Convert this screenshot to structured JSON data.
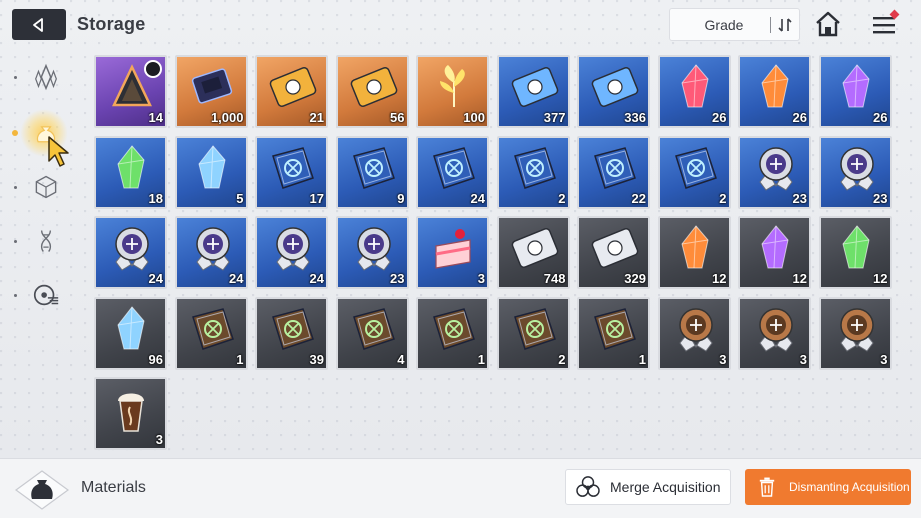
{
  "header": {
    "title": "Storage",
    "sort_label": "Grade"
  },
  "sidebar": {
    "items": [
      {
        "icon": "crystal-icon",
        "active": false
      },
      {
        "icon": "pouch-icon",
        "active": true
      },
      {
        "icon": "cube-icon",
        "active": false
      },
      {
        "icon": "dna-icon",
        "active": false
      },
      {
        "icon": "module-icon",
        "active": false
      }
    ]
  },
  "items": [
    {
      "icon": "chip-pyramid-icon",
      "grade": "purple",
      "qty": "14",
      "timer": true
    },
    {
      "icon": "memory-chip-icon",
      "grade": "orange",
      "qty": "1,000"
    },
    {
      "icon": "gold-ticket-icon",
      "grade": "orange",
      "qty": "21"
    },
    {
      "icon": "gold-compass-ticket-icon",
      "grade": "orange",
      "qty": "56"
    },
    {
      "icon": "golden-sprout-icon",
      "grade": "orange",
      "qty": "100"
    },
    {
      "icon": "blue-profile-ticket-icon",
      "grade": "blue",
      "qty": "377"
    },
    {
      "icon": "blue-compass-ticket-icon",
      "grade": "blue",
      "qty": "336"
    },
    {
      "icon": "red-crystal-icon",
      "grade": "blue",
      "qty": "26"
    },
    {
      "icon": "orange-crystal-icon",
      "grade": "blue",
      "qty": "26"
    },
    {
      "icon": "purple-crystal-icon",
      "grade": "blue",
      "qty": "26"
    },
    {
      "icon": "green-crystal-icon",
      "grade": "blue",
      "qty": "18"
    },
    {
      "icon": "blue-crystal-icon",
      "grade": "blue",
      "qty": "5"
    },
    {
      "icon": "blue-book-swords-icon",
      "grade": "blue",
      "qty": "17"
    },
    {
      "icon": "blue-book-shield-icon",
      "grade": "blue",
      "qty": "9"
    },
    {
      "icon": "blue-book-eye-icon",
      "grade": "blue",
      "qty": "24"
    },
    {
      "icon": "blue-book-wing-icon",
      "grade": "blue",
      "qty": "2"
    },
    {
      "icon": "blue-book-bolt-icon",
      "grade": "blue",
      "qty": "22"
    },
    {
      "icon": "blue-book-target-icon",
      "grade": "blue",
      "qty": "2"
    },
    {
      "icon": "silver-medal-cross-icon",
      "grade": "blue",
      "qty": "23"
    },
    {
      "icon": "silver-medal-shield-icon",
      "grade": "blue",
      "qty": "23"
    },
    {
      "icon": "silver-medal-eye-icon",
      "grade": "blue",
      "qty": "24"
    },
    {
      "icon": "silver-medal-wing-icon",
      "grade": "blue",
      "qty": "24"
    },
    {
      "icon": "silver-medal-bolt-icon",
      "grade": "blue",
      "qty": "24"
    },
    {
      "icon": "silver-medal-target-icon",
      "grade": "blue",
      "qty": "23"
    },
    {
      "icon": "strawberry-cake-icon",
      "grade": "blue",
      "qty": "3"
    },
    {
      "icon": "silver-profile-ticket-icon",
      "grade": "dark",
      "qty": "748"
    },
    {
      "icon": "silver-compass-ticket-icon",
      "grade": "dark",
      "qty": "329"
    },
    {
      "icon": "dull-orange-crystal-icon",
      "grade": "dark",
      "qty": "12"
    },
    {
      "icon": "dull-purple-crystal-icon",
      "grade": "dark",
      "qty": "12"
    },
    {
      "icon": "dull-green-crystal-icon",
      "grade": "dark",
      "qty": "12"
    },
    {
      "icon": "dull-blue-crystal-icon",
      "grade": "dark",
      "qty": "96"
    },
    {
      "icon": "brown-book-swords-icon",
      "grade": "dark",
      "qty": "1"
    },
    {
      "icon": "brown-book-shield-icon",
      "grade": "dark",
      "qty": "39"
    },
    {
      "icon": "brown-book-eye-icon",
      "grade": "dark",
      "qty": "4"
    },
    {
      "icon": "brown-book-wing-icon",
      "grade": "dark",
      "qty": "1"
    },
    {
      "icon": "brown-book-bolt-icon",
      "grade": "dark",
      "qty": "2"
    },
    {
      "icon": "brown-book-target-icon",
      "grade": "dark",
      "qty": "1"
    },
    {
      "icon": "bronze-medal-cross-icon",
      "grade": "dark",
      "qty": "3"
    },
    {
      "icon": "bronze-medal-wing-icon",
      "grade": "dark",
      "qty": "3"
    },
    {
      "icon": "bronze-medal-bolt-icon",
      "grade": "dark",
      "qty": "3"
    },
    {
      "icon": "iced-coffee-icon",
      "grade": "dark",
      "qty": "3"
    }
  ],
  "footer": {
    "category_label": "Materials",
    "merge_label": "Merge Acquisition",
    "dismantle_label": "Dismanting Acquisition"
  },
  "colors": {
    "accent": "#f07a2f",
    "blue_grade": "#3a6cc8",
    "purple_grade": "#7a4fc4",
    "orange_grade": "#e08a48",
    "dark_grade": "#44474e"
  }
}
